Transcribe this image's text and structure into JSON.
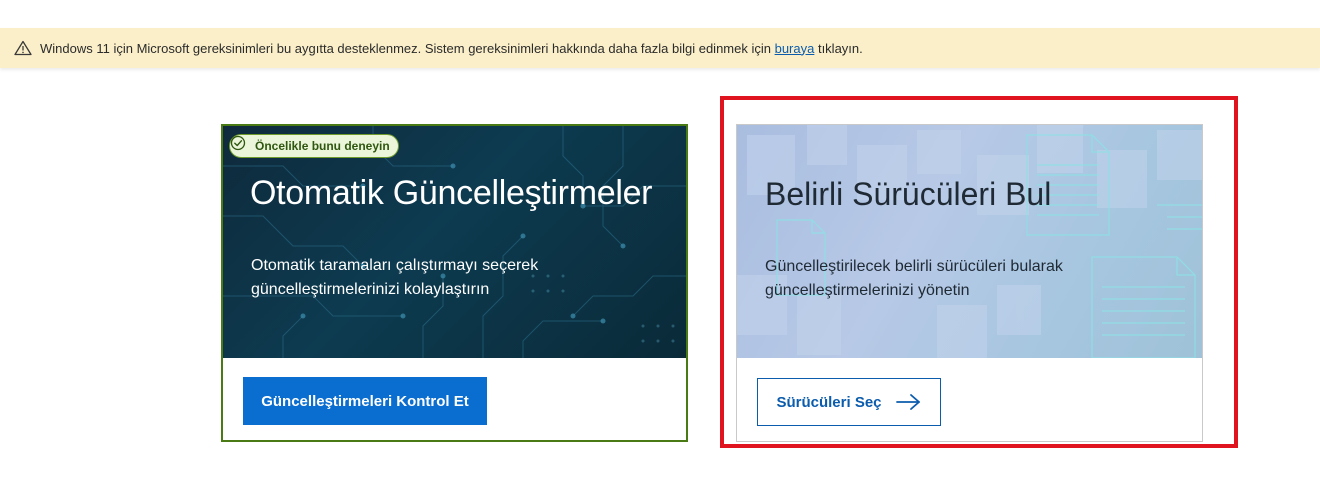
{
  "banner": {
    "icon": "warning-icon",
    "text_before": "Windows 11 için Microsoft gereksinimleri bu aygıtta desteklenmez. Sistem gereksinimleri hakkında daha fazla bilgi edinmek için ",
    "link_text": "buraya",
    "text_after": " tıklayın.",
    "background": "#fbefc9"
  },
  "cards": {
    "auto": {
      "badge": "Öncelikle bunu deneyin",
      "badge_icon": "check-circle-icon",
      "title": "Otomatik Güncelleştirmeler",
      "description": "Otomatik taramaları çalıştırmayı seçerek güncelleştirmelerinizi kolaylaştırın",
      "button": "Güncelleştirmeleri Kontrol Et",
      "border_color": "#4a7a13",
      "button_color": "#0a6ed1"
    },
    "drivers": {
      "title": "Belirli Sürücüleri Bul",
      "description": "Güncelleştirilecek belirli sürücüleri bularak güncelleştirmelerinizi yönetin",
      "button": "Sürücüleri Seç",
      "button_icon": "arrow-right-icon",
      "highlight_color": "#e0141e"
    }
  }
}
